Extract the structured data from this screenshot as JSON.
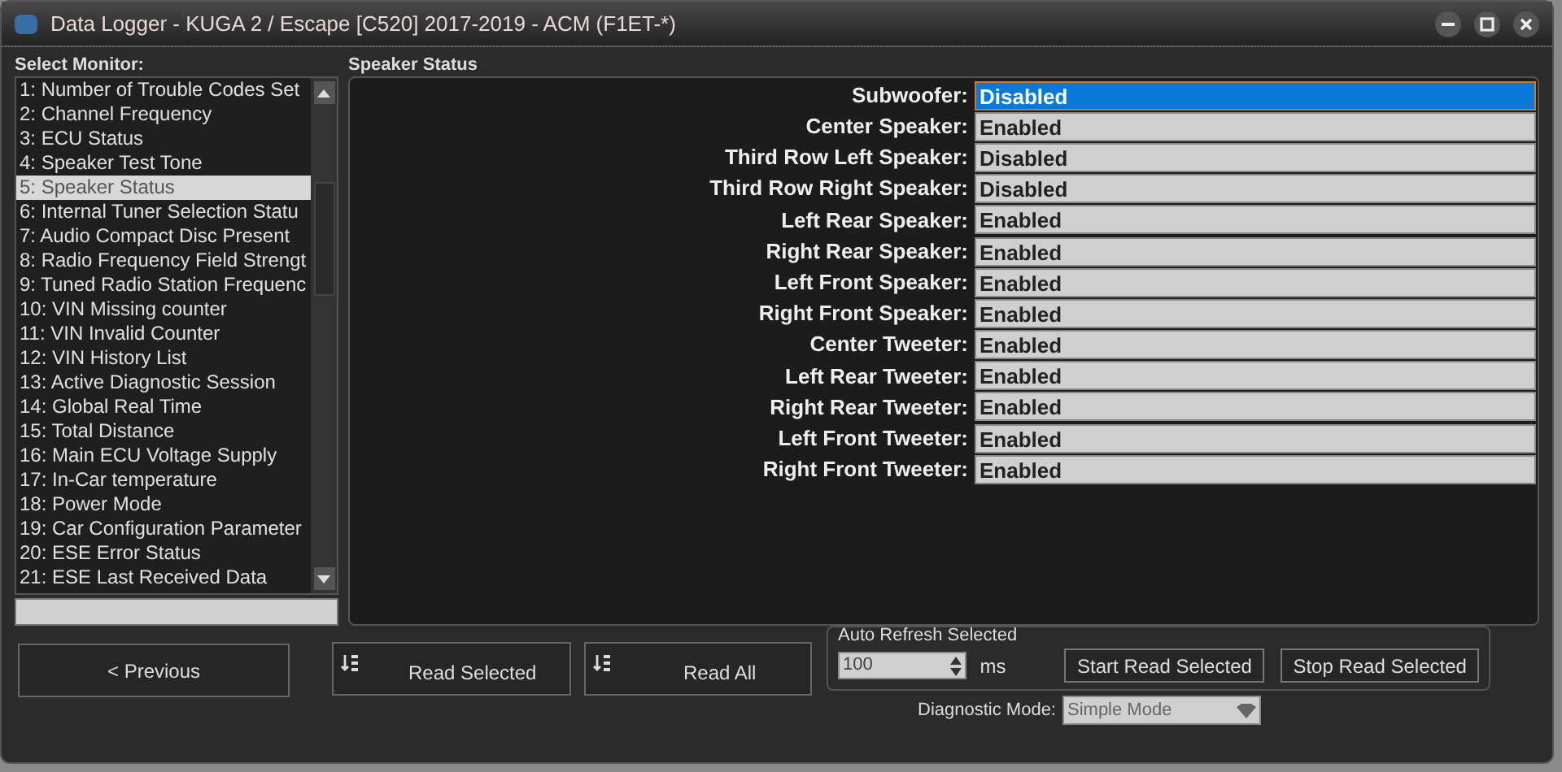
{
  "window": {
    "title": "Data Logger - KUGA 2 / Escape [C520] 2017-2019 - ACM (F1ET-*)"
  },
  "monitor_list": {
    "label": "Select Monitor:",
    "items": [
      {
        "text": "1: Number of Trouble Codes Set",
        "selected": false
      },
      {
        "text": "2: Channel Frequency",
        "selected": false
      },
      {
        "text": "3: ECU Status",
        "selected": false
      },
      {
        "text": "4: Speaker Test Tone",
        "selected": false
      },
      {
        "text": "5: Speaker Status",
        "selected": true
      },
      {
        "text": "6: Internal Tuner Selection Statu",
        "selected": false
      },
      {
        "text": "7: Audio Compact Disc Present",
        "selected": false
      },
      {
        "text": "8: Radio Frequency Field Strengt",
        "selected": false
      },
      {
        "text": "9: Tuned Radio Station Frequenc",
        "selected": false
      },
      {
        "text": "10: VIN Missing counter",
        "selected": false
      },
      {
        "text": "11: VIN Invalid Counter",
        "selected": false
      },
      {
        "text": "12: VIN History List",
        "selected": false
      },
      {
        "text": "13: Active Diagnostic Session",
        "selected": false
      },
      {
        "text": "14: Global Real Time",
        "selected": false
      },
      {
        "text": "15: Total Distance",
        "selected": false
      },
      {
        "text": "16: Main ECU Voltage Supply",
        "selected": false
      },
      {
        "text": "17: In-Car temperature",
        "selected": false
      },
      {
        "text": "18: Power Mode",
        "selected": false
      },
      {
        "text": "19: Car Configuration Parameter",
        "selected": false
      },
      {
        "text": "20: ESE Error Status",
        "selected": false
      },
      {
        "text": "21: ESE Last Received Data",
        "selected": false
      }
    ]
  },
  "status_panel": {
    "title": "Speaker Status",
    "rows": [
      {
        "label": "Subwoofer:",
        "value": "Disabled",
        "selected": true
      },
      {
        "label": "Center Speaker:",
        "value": "Enabled",
        "selected": false
      },
      {
        "label": "Third Row Left Speaker:",
        "value": "Disabled",
        "selected": false
      },
      {
        "label": "Third Row Right Speaker:",
        "value": "Disabled",
        "selected": false
      },
      {
        "label": "Left Rear Speaker:",
        "value": "Enabled",
        "selected": false
      },
      {
        "label": "Right Rear Speaker:",
        "value": "Enabled",
        "selected": false
      },
      {
        "label": "Left Front Speaker:",
        "value": "Enabled",
        "selected": false
      },
      {
        "label": "Right Front Speaker:",
        "value": "Enabled",
        "selected": false
      },
      {
        "label": "Center Tweeter:",
        "value": "Enabled",
        "selected": false
      },
      {
        "label": "Left Rear Tweeter:",
        "value": "Enabled",
        "selected": false
      },
      {
        "label": "Right Rear Tweeter:",
        "value": "Enabled",
        "selected": false
      },
      {
        "label": "Left Front Tweeter:",
        "value": "Enabled",
        "selected": false
      },
      {
        "label": "Right Front Tweeter:",
        "value": "Enabled",
        "selected": false
      }
    ]
  },
  "buttons": {
    "previous": "< Previous",
    "read_selected": "Read Selected",
    "read_all": "Read All"
  },
  "auto_refresh": {
    "label": "Auto Refresh Selected",
    "value": "100",
    "unit": "ms",
    "start": "Start Read Selected",
    "stop": "Stop Read Selected"
  },
  "diagnostic_mode": {
    "label": "Diagnostic Mode:",
    "value": "Simple Mode"
  }
}
